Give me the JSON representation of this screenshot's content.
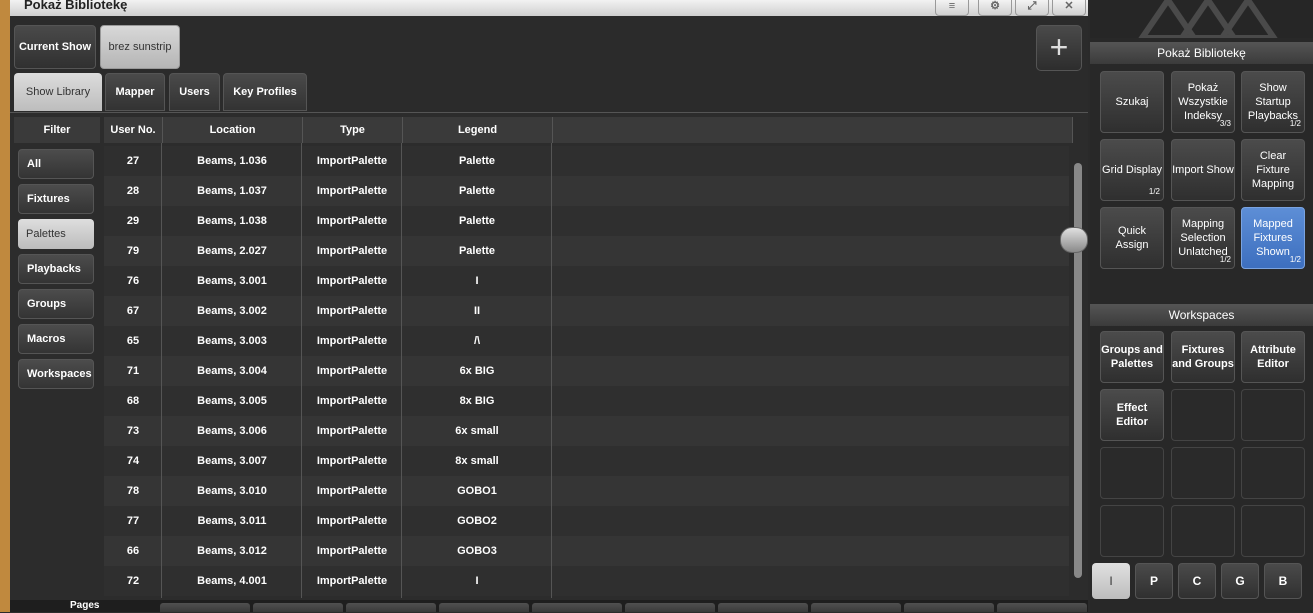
{
  "window": {
    "title": "Pokaż Bibliotekę",
    "menu_icon": "≡",
    "gear_icon": "⚙",
    "expand_icon": "⤢",
    "close_icon": "✕"
  },
  "show_chips": [
    "Current Show",
    "brez sunstrip"
  ],
  "add_icon": "+",
  "tabs": [
    "Show Library",
    "Mapper",
    "Users",
    "Key Profiles"
  ],
  "filter": {
    "header": "Filter",
    "items": [
      "All",
      "Fixtures",
      "Palettes",
      "Playbacks",
      "Groups",
      "Macros",
      "Workspaces"
    ],
    "selected": "Palettes"
  },
  "table": {
    "headers": [
      "User No.",
      "Location",
      "Type",
      "Legend"
    ],
    "rows": [
      [
        "27",
        "Beams, 1.036",
        "ImportPalette",
        "Palette"
      ],
      [
        "28",
        "Beams, 1.037",
        "ImportPalette",
        "Palette"
      ],
      [
        "29",
        "Beams, 1.038",
        "ImportPalette",
        "Palette"
      ],
      [
        "79",
        "Beams, 2.027",
        "ImportPalette",
        "Palette"
      ],
      [
        "76",
        "Beams, 3.001",
        "ImportPalette",
        "I"
      ],
      [
        "67",
        "Beams, 3.002",
        "ImportPalette",
        "II"
      ],
      [
        "65",
        "Beams, 3.003",
        "ImportPalette",
        "/\\"
      ],
      [
        "71",
        "Beams, 3.004",
        "ImportPalette",
        "6x BIG"
      ],
      [
        "68",
        "Beams, 3.005",
        "ImportPalette",
        "8x BIG"
      ],
      [
        "73",
        "Beams, 3.006",
        "ImportPalette",
        "6x small"
      ],
      [
        "74",
        "Beams, 3.007",
        "ImportPalette",
        "8x small"
      ],
      [
        "78",
        "Beams, 3.010",
        "ImportPalette",
        "GOBO1"
      ],
      [
        "77",
        "Beams, 3.011",
        "ImportPalette",
        "GOBO2"
      ],
      [
        "66",
        "Beams, 3.012",
        "ImportPalette",
        "GOBO3"
      ],
      [
        "72",
        "Beams, 4.001",
        "ImportPalette",
        "I"
      ]
    ]
  },
  "pages_label": "Pages",
  "right": {
    "section1": "Pokaż Bibliotekę",
    "buttons": [
      {
        "label": "Szukaj",
        "page": ""
      },
      {
        "label": "Pokaż Wszystkie Indeksy",
        "page": "3/3"
      },
      {
        "label": "Show Startup Playbacks",
        "page": "1/2"
      },
      {
        "label": "Grid Display",
        "page": "1/2"
      },
      {
        "label": "Import Show",
        "page": ""
      },
      {
        "label": "Clear Fixture Mapping",
        "page": ""
      },
      {
        "label": "Quick Assign",
        "page": ""
      },
      {
        "label": "Mapping Selection Unlatched",
        "page": "1/2"
      },
      {
        "label": "Mapped Fixtures Shown",
        "page": "1/2"
      }
    ],
    "section2": "Workspaces",
    "workspaces": [
      "Groups and Palettes",
      "Fixtures and Groups",
      "Attribute Editor",
      "Effect Editor"
    ],
    "letters": [
      "I",
      "P",
      "C",
      "G",
      "B"
    ],
    "active_color": "#4a7fd0"
  }
}
